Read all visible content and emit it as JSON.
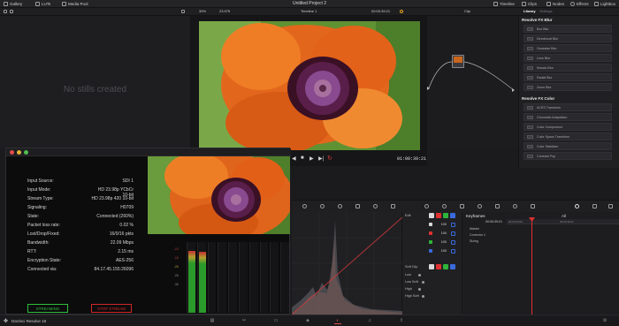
{
  "app": {
    "title": "Untitled Project 2",
    "brand": "DaVinci Resolve 18"
  },
  "topbar": {
    "left": [
      {
        "label": "Gallery",
        "icon": "gallery-icon"
      },
      {
        "label": "LUTs",
        "icon": "luts-icon"
      },
      {
        "label": "Media Pool",
        "icon": "media-pool-icon"
      }
    ],
    "right": [
      {
        "label": "Timeline",
        "icon": "timeline-icon"
      },
      {
        "label": "Clips",
        "icon": "clips-icon"
      },
      {
        "label": "Nodes",
        "icon": "nodes-icon"
      },
      {
        "label": "Effects",
        "icon": "effects-icon"
      },
      {
        "label": "Lightbox",
        "icon": "lightbox-icon"
      }
    ]
  },
  "toolbar2": {
    "zoom": "39%",
    "timecode_left": "23.975",
    "timeline": "Timeline 1",
    "timecode": "00:00:39:21",
    "clip": "Clip",
    "library_tab": "Library",
    "settings_tab": "Settings"
  },
  "gallery": {
    "empty_message": "No stills created"
  },
  "viewer": {
    "timecode": "01:00:39:21"
  },
  "library": {
    "groups": [
      {
        "title": "Resolve FX Blur",
        "items": [
          "Box Blur",
          "Directional Blur",
          "Gaussian Blur",
          "Lens Blur",
          "Mosaic Blur",
          "Radial Blur",
          "Zoom Blur"
        ]
      },
      {
        "title": "Resolve FX Color",
        "items": [
          "ACES Transform",
          "Chromatic Adaptation",
          "Color Compressor",
          "Color Space Transform",
          "Color Stabilizer",
          "Contrast Pop"
        ]
      }
    ]
  },
  "stream": {
    "fields": [
      {
        "label": "Input Source:",
        "value": "SDI 1"
      },
      {
        "label": "Input Mode:",
        "value": "HD 23.98p YCbCr 10-bit"
      },
      {
        "label": "Stream Type:",
        "value": "HD 23.98p 420 10-bit"
      },
      {
        "label": "Signaling:",
        "value": "H0709"
      },
      {
        "label": "State:",
        "value": "Connected (260%)"
      },
      {
        "label": "Packet loss rate:",
        "value": "0.02 %"
      },
      {
        "label": "Lost/Drop/Fixed:",
        "value": "16/0/16 pkts"
      },
      {
        "label": "Bandwidth:",
        "value": "22.09 Mbps"
      },
      {
        "label": "RTT:",
        "value": "2.15 ms"
      },
      {
        "label": "Encryption State:",
        "value": "AES-256"
      },
      {
        "label": "Connected via:",
        "value": "84.17.45.155:26096"
      }
    ],
    "streaming_button": "STREAMING",
    "stop_button": "STOP STREAM",
    "meter_scale": [
      "-10",
      "-15",
      "-20",
      "-25",
      "-30"
    ],
    "meter_levels": [
      0.88,
      0.86,
      0,
      0,
      0,
      0,
      0,
      0,
      0,
      0
    ],
    "colors": {
      "streaming": "#2fbf3b",
      "stop": "#d02626"
    }
  },
  "mixer": {
    "edit_label": "Edit",
    "soft_clip_label": "Soft Clip",
    "channels": [
      {
        "color": "#d9d9d9",
        "value": "100"
      },
      {
        "color": "#e03030",
        "value": "100"
      },
      {
        "color": "#2fb43a",
        "value": "100"
      },
      {
        "color": "#3a6bdc",
        "value": "100"
      }
    ],
    "soft_rows": [
      "Low",
      "Low Soft",
      "High",
      "High Soft"
    ]
  },
  "keyframes": {
    "title": "Keyframes",
    "filter": "All",
    "timecode": "00:00:39:21",
    "tracks": [
      "Master",
      "Corrector 1",
      "Sizing"
    ],
    "ruler": [
      "00:00:00:00",
      "00:00:39:21"
    ]
  },
  "pagebar": {
    "pages": [
      "media-page-icon",
      "cut-page-icon",
      "edit-page-icon",
      "fusion-page-icon",
      "color-page-icon",
      "fairlight-page-icon",
      "deliver-page-icon"
    ],
    "active_page": 4
  }
}
